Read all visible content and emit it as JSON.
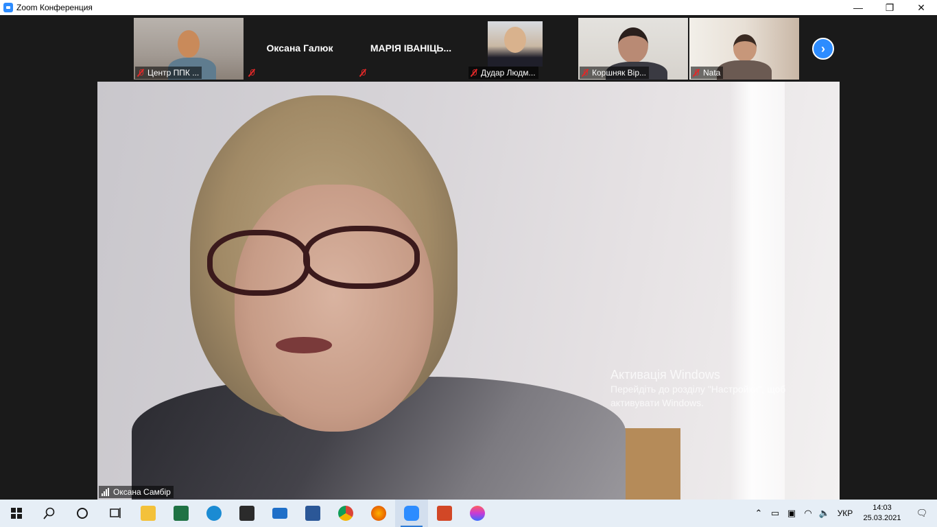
{
  "window": {
    "title": "Zoom Конференция",
    "controls": {
      "minimize": "—",
      "restore": "❐",
      "close": "✕"
    }
  },
  "participants": [
    {
      "name": "Центр ППК ...",
      "has_video": true,
      "muted": true
    },
    {
      "name": "Оксана Галюк",
      "has_video": false,
      "muted": true
    },
    {
      "name": "МАРІЯ ІВАНІЦЬ...",
      "has_video": false,
      "muted": true
    },
    {
      "name": "Дудар Людм...",
      "has_video": true,
      "muted": true
    },
    {
      "name": "Коршняк Вір...",
      "has_video": true,
      "muted": true
    },
    {
      "name": "Nata",
      "has_video": true,
      "muted": true
    }
  ],
  "main_speaker": {
    "name": "Оксана Самбір"
  },
  "activation": {
    "heading": "Активація Windows",
    "line1": "Перейдіть до розділу \"Настройки\", щоб",
    "line2": "активувати Windows."
  },
  "taskbar": {
    "apps": [
      {
        "name": "start-icon",
        "color": "#1a1a1a"
      },
      {
        "name": "search-icon",
        "color": "#1a1a1a"
      },
      {
        "name": "cortana-icon",
        "color": "#1a1a1a"
      },
      {
        "name": "task-view-icon",
        "color": "#1a1a1a"
      },
      {
        "name": "file-explorer-icon",
        "color": "#f3c13a"
      },
      {
        "name": "excel-icon",
        "color": "#1f7244"
      },
      {
        "name": "edge-icon",
        "color": "#1b8bd3"
      },
      {
        "name": "store-icon",
        "color": "#2b2b2b"
      },
      {
        "name": "mail-icon",
        "color": "#1f6fc8"
      },
      {
        "name": "word-icon",
        "color": "#2b5797"
      },
      {
        "name": "chrome-icon",
        "color": "#db4437"
      },
      {
        "name": "firefox-icon",
        "color": "#e66000"
      },
      {
        "name": "zoom-icon",
        "color": "#2d8cff"
      },
      {
        "name": "presentation-icon",
        "color": "#d24726"
      },
      {
        "name": "drop-icon",
        "color": "#c83ad6"
      }
    ],
    "language": "УКР",
    "time": "14:03",
    "date": "25.03.2021"
  }
}
